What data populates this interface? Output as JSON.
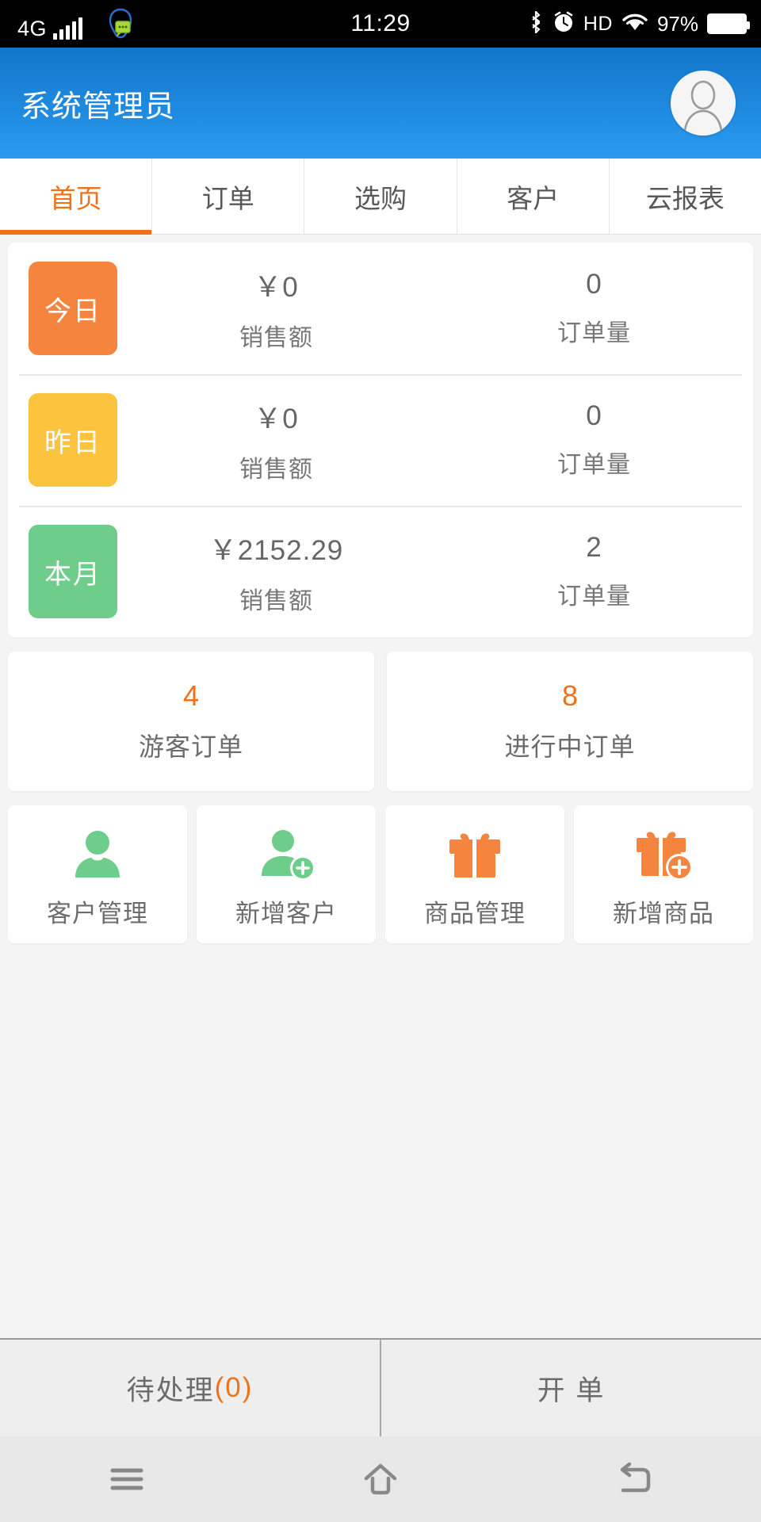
{
  "statusbar": {
    "network": "4G",
    "signal_icon": "signal-bars-icon",
    "app_icon": "qq-message-icon",
    "time": "11:29",
    "bluetooth_icon": "bluetooth-icon",
    "alarm_icon": "alarm-clock-icon",
    "hd": "HD",
    "wifi_icon": "wifi-icon",
    "battery_pct": "97%",
    "battery_icon": "battery-full-icon"
  },
  "header": {
    "title": "系统管理员",
    "avatar_icon": "user-avatar-icon",
    "bg_color": "#1c86db"
  },
  "tabs": [
    {
      "label": "首页",
      "active": true
    },
    {
      "label": "订单",
      "active": false
    },
    {
      "label": "选购",
      "active": false
    },
    {
      "label": "客户",
      "active": false
    },
    {
      "label": "云报表",
      "active": false
    }
  ],
  "accent_color": "#f07218",
  "stats": {
    "columns": [
      "销售额",
      "订单量"
    ],
    "rows": [
      {
        "period": "今日",
        "badge_color": "#f5843e",
        "sales": "￥0",
        "orders": "0",
        "sales_label": "销售额",
        "orders_label": "订单量"
      },
      {
        "period": "昨日",
        "badge_color": "#fbc33e",
        "sales": "￥0",
        "orders": "0",
        "sales_label": "销售额",
        "orders_label": "订单量"
      },
      {
        "period": "本月",
        "badge_color": "#6ecd8a",
        "sales": "￥2152.29",
        "orders": "2",
        "sales_label": "销售额",
        "orders_label": "订单量"
      }
    ]
  },
  "order_cards": [
    {
      "count": "4",
      "label": "游客订单"
    },
    {
      "count": "8",
      "label": "进行中订单"
    }
  ],
  "shortcuts": [
    {
      "label": "客户管理",
      "icon": "person-icon",
      "color": "#6ecd8a"
    },
    {
      "label": "新增客户",
      "icon": "person-add-icon",
      "color": "#6ecd8a"
    },
    {
      "label": "商品管理",
      "icon": "gift-box-icon",
      "color": "#f5843e"
    },
    {
      "label": "新增商品",
      "icon": "gift-box-add-icon",
      "color": "#f5843e"
    }
  ],
  "actionbar": {
    "pending_label": "待处理",
    "pending_count": "(0)",
    "create_order_label": "开  单"
  },
  "navbar": {
    "menu_icon": "menu-icon",
    "home_icon": "home-icon",
    "back_icon": "back-icon"
  }
}
